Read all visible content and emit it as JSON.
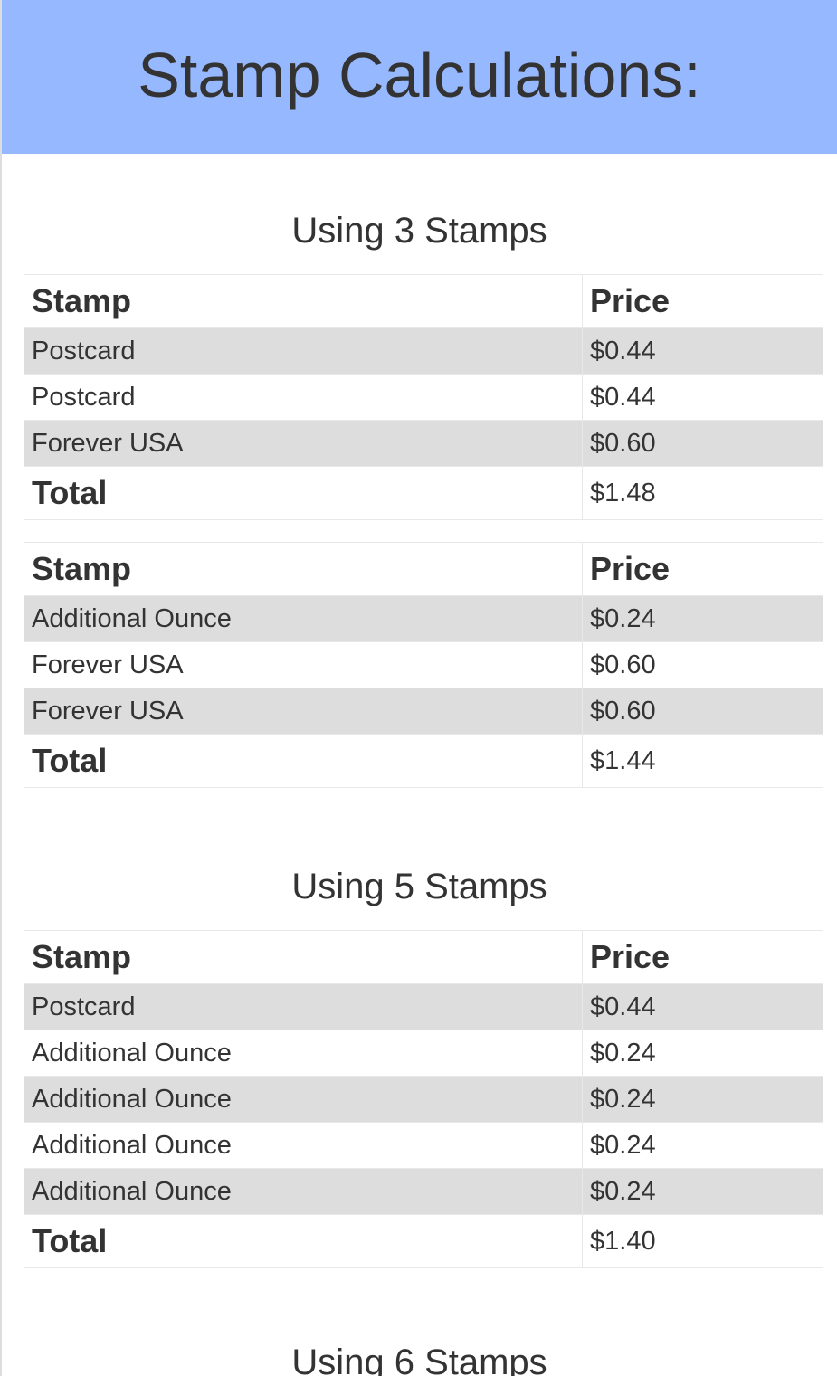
{
  "page_title": "Stamp Calculations:",
  "headers": {
    "stamp": "Stamp",
    "price": "Price"
  },
  "total_label": "Total",
  "sections": [
    {
      "title": "Using 3 Stamps",
      "tables": [
        {
          "rows": [
            {
              "stamp": "Postcard",
              "price": "$0.44"
            },
            {
              "stamp": "Postcard",
              "price": "$0.44"
            },
            {
              "stamp": "Forever USA",
              "price": "$0.60"
            }
          ],
          "total": "$1.48"
        },
        {
          "rows": [
            {
              "stamp": "Additional Ounce",
              "price": "$0.24"
            },
            {
              "stamp": "Forever USA",
              "price": "$0.60"
            },
            {
              "stamp": "Forever USA",
              "price": "$0.60"
            }
          ],
          "total": "$1.44"
        }
      ]
    },
    {
      "title": "Using 5 Stamps",
      "tables": [
        {
          "rows": [
            {
              "stamp": "Postcard",
              "price": "$0.44"
            },
            {
              "stamp": "Additional Ounce",
              "price": "$0.24"
            },
            {
              "stamp": "Additional Ounce",
              "price": "$0.24"
            },
            {
              "stamp": "Additional Ounce",
              "price": "$0.24"
            },
            {
              "stamp": "Additional Ounce",
              "price": "$0.24"
            }
          ],
          "total": "$1.40"
        }
      ]
    },
    {
      "title": "Using 6 Stamps",
      "tables": []
    }
  ]
}
